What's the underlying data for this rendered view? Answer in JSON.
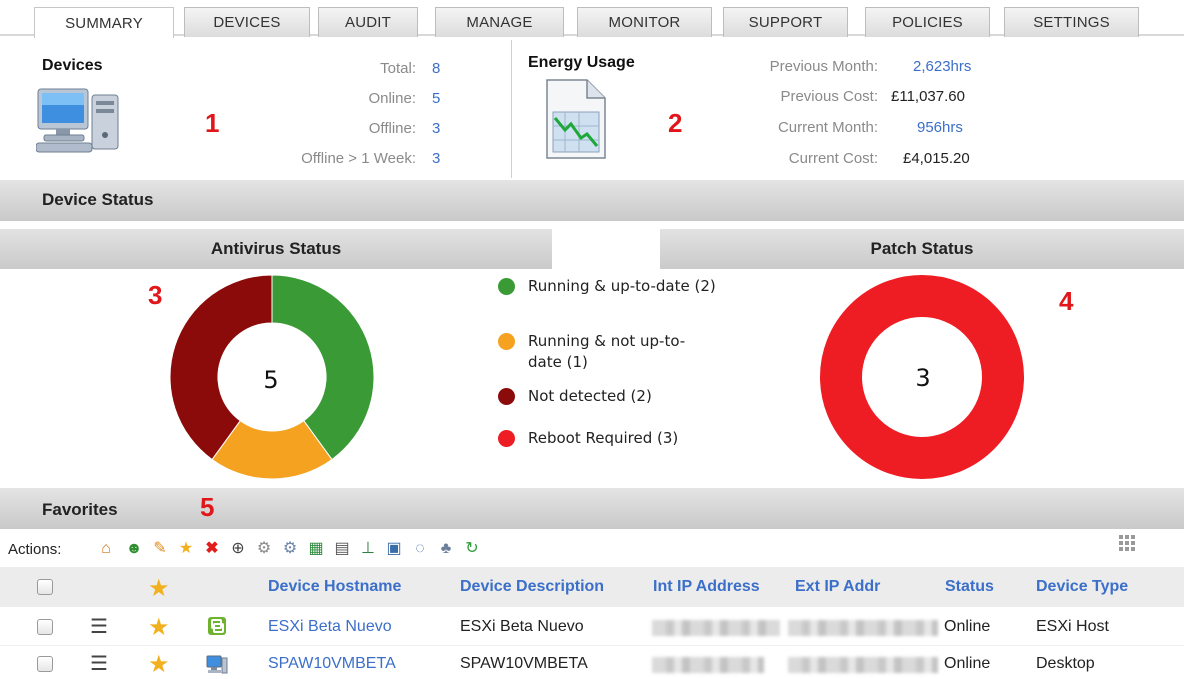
{
  "tabs": [
    "SUMMARY",
    "DEVICES",
    "AUDIT",
    "MANAGE",
    "MONITOR",
    "SUPPORT",
    "POLICIES",
    "SETTINGS"
  ],
  "devices_box": {
    "title": "Devices",
    "marker": "1",
    "rows": [
      {
        "label": "Total:",
        "value": "8"
      },
      {
        "label": "Online:",
        "value": "5"
      },
      {
        "label": "Offline:",
        "value": "3"
      },
      {
        "label": "Offline > 1 Week:",
        "value": "3"
      }
    ]
  },
  "energy_box": {
    "title": "Energy Usage",
    "marker": "2",
    "rows": [
      {
        "label": "Previous Month:",
        "value": "2,623hrs"
      },
      {
        "label": "Previous Cost:",
        "value": "£11,037.60"
      },
      {
        "label": "Current Month:",
        "value": "956hrs"
      },
      {
        "label": "Current Cost:",
        "value": "£4,015.20"
      }
    ]
  },
  "device_status": {
    "title": "Device Status"
  },
  "antivirus": {
    "title": "Antivirus Status",
    "marker": "3",
    "center_label": "5"
  },
  "patch": {
    "title": "Patch Status",
    "marker": "4",
    "center_label": "3"
  },
  "legend": [
    {
      "label": "Running & up-to-date (2)",
      "color": "#3a9a35"
    },
    {
      "label": "Running & not up-to-date (1)",
      "color": "#f4a21f"
    },
    {
      "label": "Not detected (2)",
      "color": "#8b0a0a"
    },
    {
      "label": "Reboot Required (3)",
      "color": "#ee1c23"
    }
  ],
  "chart_data": [
    {
      "type": "pie",
      "title": "Antivirus Status",
      "categories": [
        "Running & up-to-date",
        "Running & not up-to-date",
        "Not detected"
      ],
      "values": [
        2,
        1,
        2
      ],
      "colors": [
        "#3a9a35",
        "#f4a21f",
        "#8b0a0a"
      ],
      "total": 5
    },
    {
      "type": "pie",
      "title": "Patch Status",
      "categories": [
        "Reboot Required"
      ],
      "values": [
        3
      ],
      "colors": [
        "#ee1c23"
      ],
      "total": 3
    }
  ],
  "favorites": {
    "title": "Favorites",
    "marker": "5",
    "actions_label": "Actions:"
  },
  "toolbar_icons": [
    "add-site-icon",
    "add-users-icon",
    "edit-pencil-icon",
    "favorite-star-icon",
    "delete-x-icon",
    "binoculars-icon",
    "gear-icon",
    "gears-icon",
    "excel-export-icon",
    "server-icon",
    "network-icon",
    "remote-desktop-icon",
    "chat-icon",
    "user-lock-icon",
    "refresh-icon"
  ],
  "table": {
    "columns": [
      "Device Hostname",
      "Device Description",
      "Int IP Address",
      "Ext IP Addr",
      "Status",
      "Device Type"
    ],
    "rows": [
      {
        "hostname": "ESXi Beta Nuevo",
        "description": "ESXi Beta Nuevo",
        "status": "Online",
        "type": "ESXi Host",
        "icon": "vmware-icon"
      },
      {
        "hostname": "SPAW10VMBETA",
        "description": "SPAW10VMBETA",
        "status": "Online",
        "type": "Desktop",
        "icon": "desktop-icon"
      }
    ]
  }
}
